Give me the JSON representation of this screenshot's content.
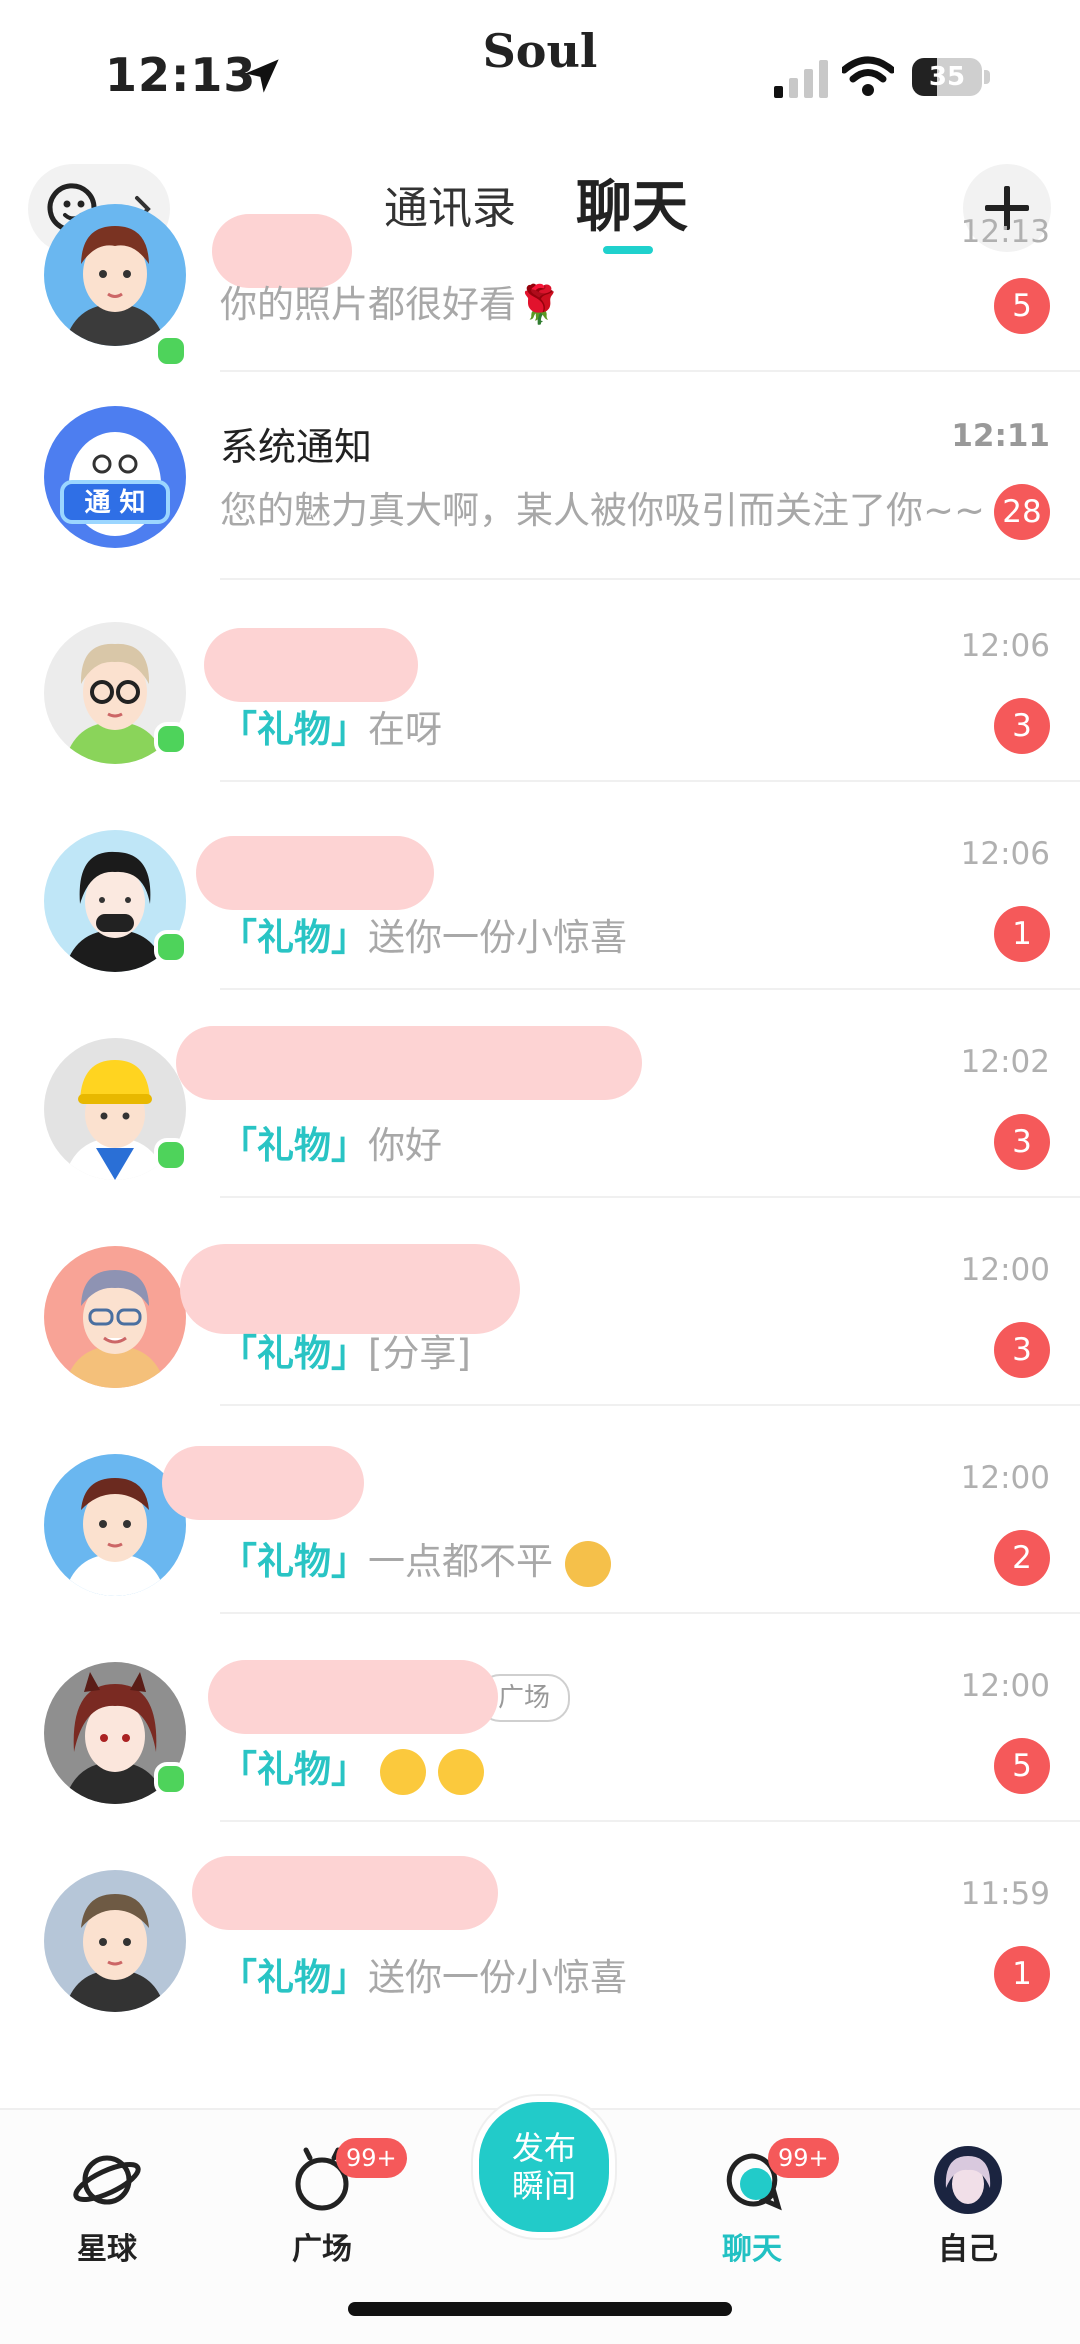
{
  "status_bar": {
    "time": "12:13",
    "app_brand": "Soul",
    "battery": "35"
  },
  "header": {
    "tab_contacts": "通讯录",
    "tab_chat": "聊天",
    "active_tab": "聊天"
  },
  "chats": [
    {
      "time": "12:13",
      "message": "你的照片都很好看🌹",
      "unread": "5",
      "online": true
    },
    {
      "name": "系统通知",
      "time": "12:11",
      "message": "您的魅力真大啊，某人被你吸引而关注了你~~",
      "unread": "28",
      "online": false
    },
    {
      "time": "12:06",
      "gift": "「礼物」",
      "message": "在呀",
      "unread": "3",
      "online": true
    },
    {
      "time": "12:06",
      "gift": "「礼物」",
      "message": "送你一份小惊喜",
      "unread": "1",
      "online": true
    },
    {
      "time": "12:02",
      "gift": "「礼物」",
      "message": "你好",
      "unread": "3",
      "online": true
    },
    {
      "time": "12:00",
      "gift": "「礼物」",
      "message": "[分享]",
      "unread": "3",
      "online": false
    },
    {
      "time": "12:00",
      "gift": "「礼物」",
      "message": "一点都不平",
      "unread": "2",
      "online": false
    },
    {
      "time": "12:00",
      "gift": "「礼物」",
      "tag": "广场",
      "message": "",
      "unread": "5",
      "online": true
    },
    {
      "time": "11:59",
      "gift": "「礼物」",
      "message": "送你一份小惊喜",
      "unread": "1",
      "online": false
    }
  ],
  "bottom_nav": {
    "planet": "星球",
    "square": "广场",
    "square_badge": "99+",
    "publish_line1": "发布",
    "publish_line2": "瞬间",
    "chat": "聊天",
    "chat_badge": "99+",
    "me": "自己"
  },
  "colors": {
    "accent": "#22cbc9",
    "badge": "#f5595a",
    "gift_text": "#29c4c4",
    "online": "#4ed35b",
    "redaction": "#fdd3d3"
  }
}
